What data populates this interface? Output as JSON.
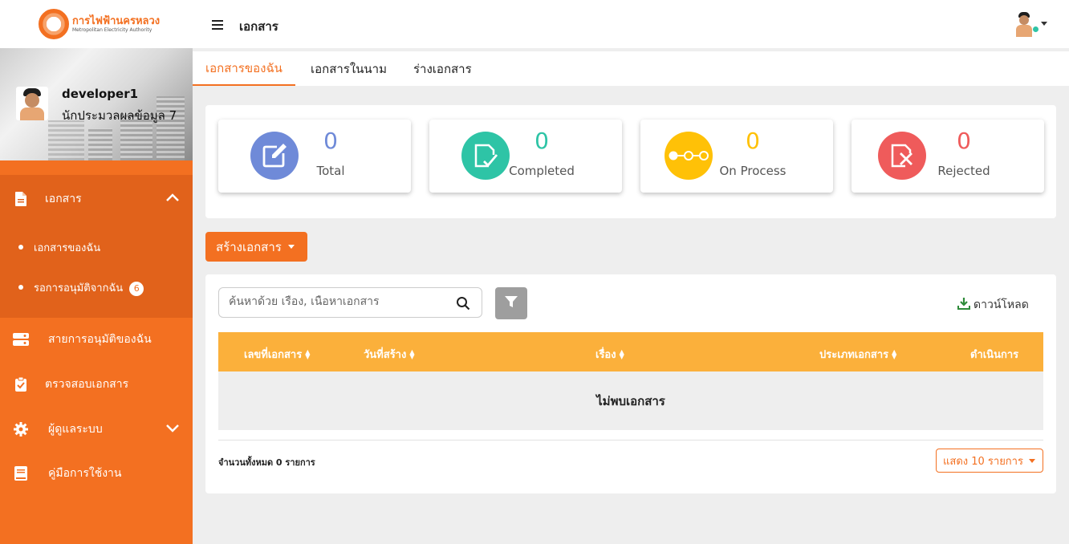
{
  "brand": {
    "name_th": "การไฟฟ้านครหลวง",
    "name_en": "Metropolitan Electricity Authority"
  },
  "profile": {
    "username": "developer1",
    "role": "นักประมวลผลข้อมูล 7"
  },
  "sidebar": {
    "documents": {
      "label": "เอกสาร",
      "icon": "file-icon",
      "expanded": true
    },
    "sub_items": [
      {
        "label": "เอกสารของฉัน",
        "active": true
      },
      {
        "label": "รอการอนุมัติจากฉัน",
        "badge": "6"
      }
    ],
    "items": [
      {
        "label": "สายการอนุมัติของฉัน",
        "icon": "workflow-icon"
      },
      {
        "label": "ตรวจสอบเอกสาร",
        "icon": "clipboard-check-icon"
      },
      {
        "label": "ผู้ดูแลระบบ",
        "icon": "gear-icon",
        "has_children": true
      },
      {
        "label": "คู่มือการใช้งาน",
        "icon": "book-icon"
      }
    ]
  },
  "topbar": {
    "title": "เอกสาร"
  },
  "tabs": [
    {
      "label": "เอกสารของฉัน",
      "active": true
    },
    {
      "label": "เอกสารในนาม",
      "active": false
    },
    {
      "label": "ร่างเอกสาร",
      "active": false
    }
  ],
  "stats": [
    {
      "value": "0",
      "label": "Total",
      "color": "#6f8ad8",
      "icon": "edit-icon"
    },
    {
      "value": "0",
      "label": "Completed",
      "color": "#2ec4a6",
      "icon": "document-check-icon"
    },
    {
      "value": "0",
      "label": "On Process",
      "color": "#ffc107",
      "icon": "process-icon"
    },
    {
      "value": "0",
      "label": "Rejected",
      "color": "#ef5b5b",
      "icon": "document-reject-icon"
    }
  ],
  "actions": {
    "create_label": "สร้างเอกสาร"
  },
  "search": {
    "placeholder": "ค้นหาด้วย เรื่อง, เนื้อหาเอกสาร",
    "value": ""
  },
  "download_label": "ดาวน์โหลด",
  "table": {
    "columns": [
      "เลขที่เอกสาร",
      "วันที่สร้าง",
      "เรื่อง",
      "ประเภทเอกสาร",
      "ดำเนินการ"
    ],
    "empty_message": "ไม่พบเอกสาร",
    "total_text": "จำนวนทั้งหมด 0 รายการ",
    "page_size_label": "แสดง 10 รายการ"
  },
  "colors": {
    "primary": "#f37021",
    "header": "#fbb03b"
  }
}
